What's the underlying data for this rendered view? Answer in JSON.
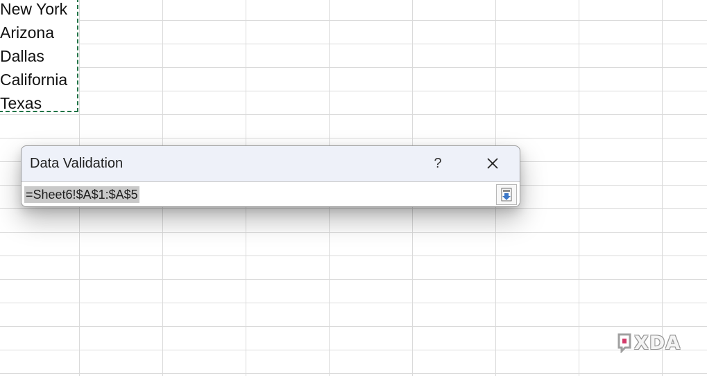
{
  "sheet": {
    "cells": [
      "New York",
      "Arizona",
      "Dallas",
      "California",
      "Texas"
    ]
  },
  "dialog": {
    "title": "Data Validation",
    "help_label": "?",
    "close_icon": "close-icon",
    "range_value": "=Sheet6!$A$1:$A$5",
    "collapse_icon": "collapse-dialog-icon"
  },
  "watermark": {
    "text": "XDA",
    "icon": "xda-logo-icon"
  },
  "colors": {
    "marquee": "#217346",
    "dialog_title_bar": "#eef1f9",
    "selection_highlight": "#c9c9c9",
    "collapse_icon_accent": "#3c78c8"
  }
}
